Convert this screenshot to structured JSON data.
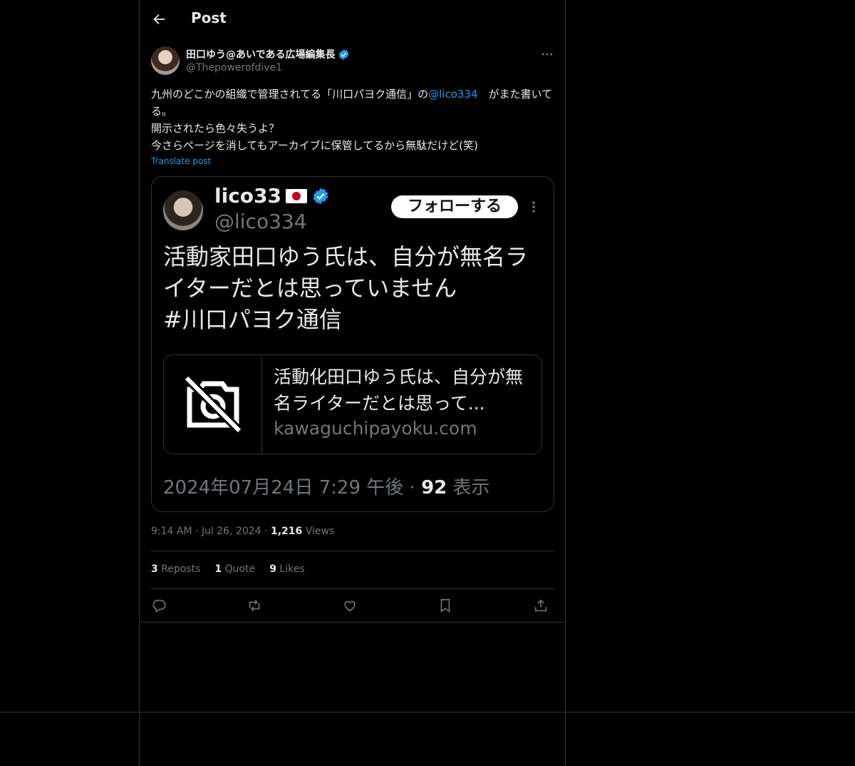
{
  "header": {
    "title": "Post"
  },
  "post": {
    "author_name": "田口ゆう@あいである広場編集長",
    "author_handle": "@Thepowerofdive1",
    "text_before": "九州のどこかの組織で管理されてる「川口パヨク通信」の",
    "mention": "@lico334",
    "text_after": "　がまた書いてる。\n開示されたら色々失うよ？\n今さらページを消してもアーカイブに保管してるから無駄だけど(笑)",
    "translate_label": "Translate post",
    "time": "9:14 AM",
    "date": "Jul 26, 2024",
    "views_count": "1,216",
    "views_label": "Views",
    "reposts_count": "3",
    "reposts_label": "Reposts",
    "quotes_count": "1",
    "quotes_label": "Quote",
    "likes_count": "9",
    "likes_label": "Likes"
  },
  "embedded": {
    "name": "lico33",
    "handle": "@lico334",
    "follow_label": "フォローする",
    "text": "活動家田口ゆう氏は、自分が無名ライターだとは思っていません\n#川口パヨク通信",
    "link_title": "活動化田口ゆう氏は、自分が無名ライターだとは思って...",
    "link_domain": "kawaguchipayoku.com",
    "timestamp": "2024年07月24日 7:29 午後",
    "separator": "·",
    "views_count": "92",
    "views_label": "表示"
  },
  "colors": {
    "accent": "#1d9bf0",
    "muted": "#71767b",
    "text": "#e7e9ea",
    "border": "#2f3336"
  },
  "icons": [
    "back-arrow-icon",
    "verified-badge-icon",
    "more-icon",
    "flag-japan-icon",
    "image-unavailable-icon",
    "reply-icon",
    "repost-icon",
    "like-icon",
    "bookmark-icon",
    "share-icon"
  ]
}
